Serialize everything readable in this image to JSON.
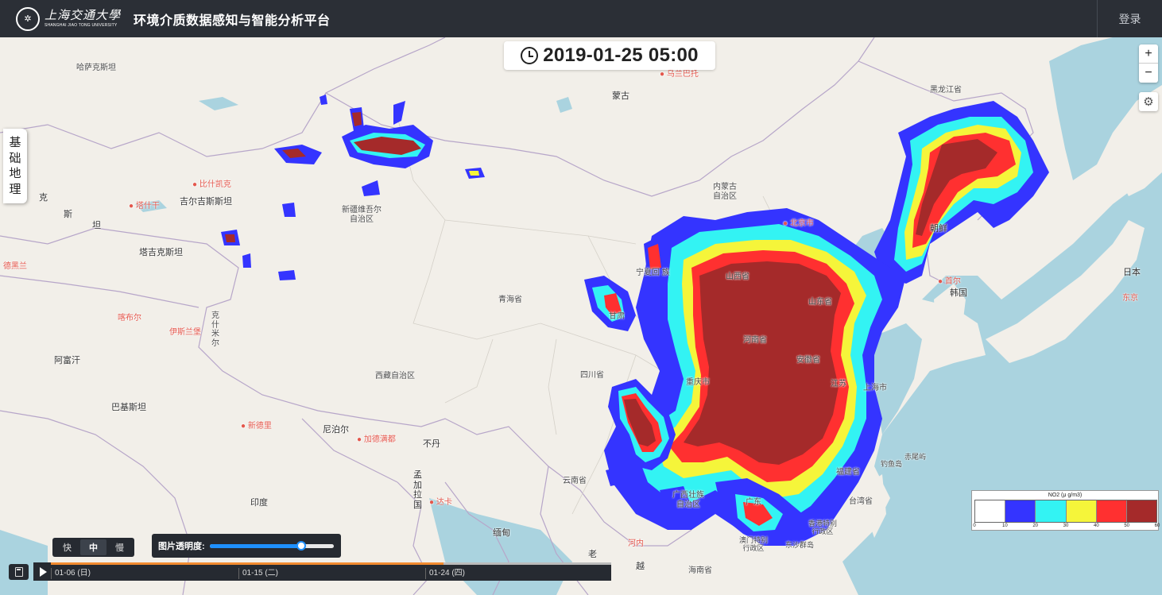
{
  "header": {
    "logo_cn": "上海交通大學",
    "logo_en": "SHANGHAI JIAO TONG UNIVERSITY",
    "title": "环境介质数据感知与智能分析平台",
    "login_label": "登录"
  },
  "current_time": "2019-01-25 05:00",
  "map": {
    "zoom_in_label": "+",
    "zoom_out_label": "−",
    "basemap_label": [
      "基",
      "础",
      "地",
      "理"
    ],
    "places": {
      "kazakhstan": "哈萨克斯坦",
      "mongolia": "蒙古",
      "ulaanbaatar": "乌兰巴托",
      "heilongjiang": "黑龙江省",
      "inner_mongolia_1": "内蒙古",
      "inner_mongolia_2": "自治区",
      "xinjiang_1": "新疆维吾尔",
      "xinjiang_2": "自治区",
      "bishkek": "比什凯克",
      "tashkent": "塔什干",
      "kyrgyzstan": "吉尔吉斯斯坦",
      "tajikistan": "塔吉克斯坦",
      "beijing": "北京市",
      "ningxia_1": "宁夏回",
      "ningxia_2": "族",
      "shanxi": "山西省",
      "shandong": "山东省",
      "qinghai": "青海省",
      "gansu": "甘肃",
      "henan": "河南省",
      "anhui": "安徽省",
      "sichuan": "四川省",
      "chongqing": "重庆市",
      "tibet": "西藏自治区",
      "yunnan": "云南省",
      "guangxi_1": "广西壮族",
      "guangxi_2": "自治区",
      "fujian": "福建省",
      "taiwan": "台湾省",
      "hongkong_1": "香港特别",
      "hongkong_2": "行政区",
      "macau_1": "澳门特别",
      "macau_2": "行政区",
      "hainan": "海南省",
      "north_korea": "朝鲜",
      "south_korea": "韩国",
      "seoul": "首尔",
      "japan": "日本",
      "tokyo": "东京",
      "afghanistan": "阿富汗",
      "pakistan": "巴基斯坦",
      "kabul": "喀布尔",
      "islamabad": "伊斯兰堡",
      "india": "印度",
      "new_delhi": "新德里",
      "nepal": "尼泊尔",
      "kathmandu": "加德满都",
      "bhutan": "不丹",
      "bangladesh": "孟加拉国",
      "dhaka": "达卡",
      "myanmar": "缅甸",
      "laos": "老",
      "vietnam": "越",
      "hanoi": "河内",
      "kashmir": "克什米尔",
      "ke": "克",
      "si": "斯",
      "tan": "坦",
      "tehran": "德黑兰",
      "shanghai": "上海市",
      "jiangsu": "江苏",
      "guangdong": "广东",
      "dongsha": "东沙群岛",
      "diaoyu": "钓鱼岛",
      "chiwei": "赤尾屿"
    }
  },
  "legend": {
    "title": "NO2 (μ g/m3)",
    "colors": [
      "#ffffff",
      "#3434ff",
      "#33f3f3",
      "#f5f53a",
      "#ff3030",
      "#a52a2a"
    ],
    "ticks": [
      "0",
      "10",
      "20",
      "30",
      "40",
      "50",
      "60"
    ]
  },
  "controls": {
    "speed_options": [
      "快",
      "中",
      "慢"
    ],
    "speed_selected": "中",
    "opacity_label": "图片透明度:",
    "opacity_value": 0.74
  },
  "timeline": {
    "progress": 0.7,
    "ticks": [
      "01-06 (日)",
      "01-15 (二)",
      "01-24 (四)"
    ]
  }
}
